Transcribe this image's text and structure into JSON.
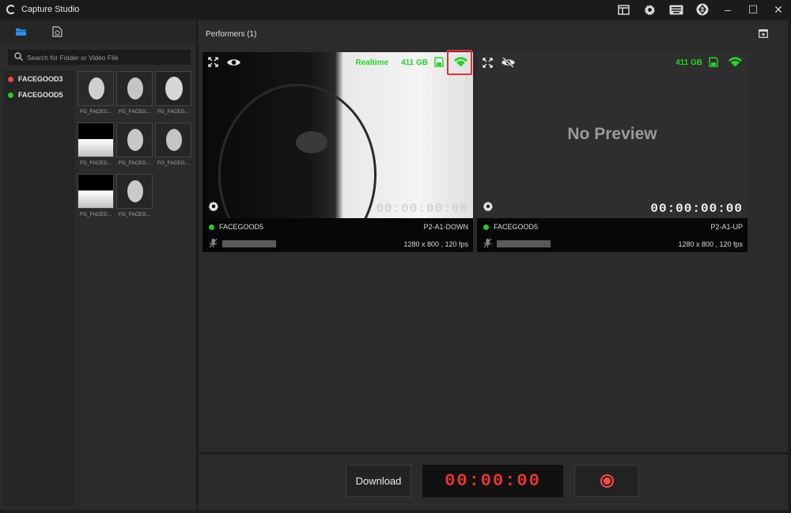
{
  "app": {
    "title": "Capture Studio"
  },
  "titlebar": {
    "icons": [
      "layout-icon",
      "gear-icon",
      "keyboard-icon",
      "network-logo-icon"
    ],
    "minimize": "–",
    "maximize": "☐",
    "close": "✕"
  },
  "left": {
    "search_placeholder": "Search for Folder or Video File",
    "devices": [
      {
        "name": "FACEGOOD3",
        "status_color": "#e84b4b"
      },
      {
        "name": "FACEGOOD5",
        "status_color": "#2bc52b"
      }
    ],
    "thumbnails": [
      "FG_FACEG...",
      "FG_FACEG...",
      "FG_FACEG...",
      "FG_FACEG...",
      "FG_FACEG...",
      "FG_FACEG...",
      "FG_FACEG...",
      "FG_FACEG..."
    ]
  },
  "main": {
    "header": "Performers (1)",
    "cards": [
      {
        "mode": "Realtime",
        "storage": "411 GB",
        "timecode": "00:00:00:00",
        "device": "FACEGOOD5",
        "camera": "P2-A1-DOWN",
        "resolution": "1280 x 800 , 120 fps"
      },
      {
        "no_preview": "No Preview",
        "storage": "411 GB",
        "timecode": "00:00:00:00",
        "device": "FACEGOOD5",
        "camera": "P2-A1-UP",
        "resolution": "1280 x 800 , 120 fps"
      }
    ]
  },
  "bottom": {
    "download_label": "Download",
    "timer": "00:00:00"
  },
  "colors": {
    "accent_green": "#2bd12b",
    "record_red": "#ff4a4a",
    "highlight": "#e0303a"
  }
}
